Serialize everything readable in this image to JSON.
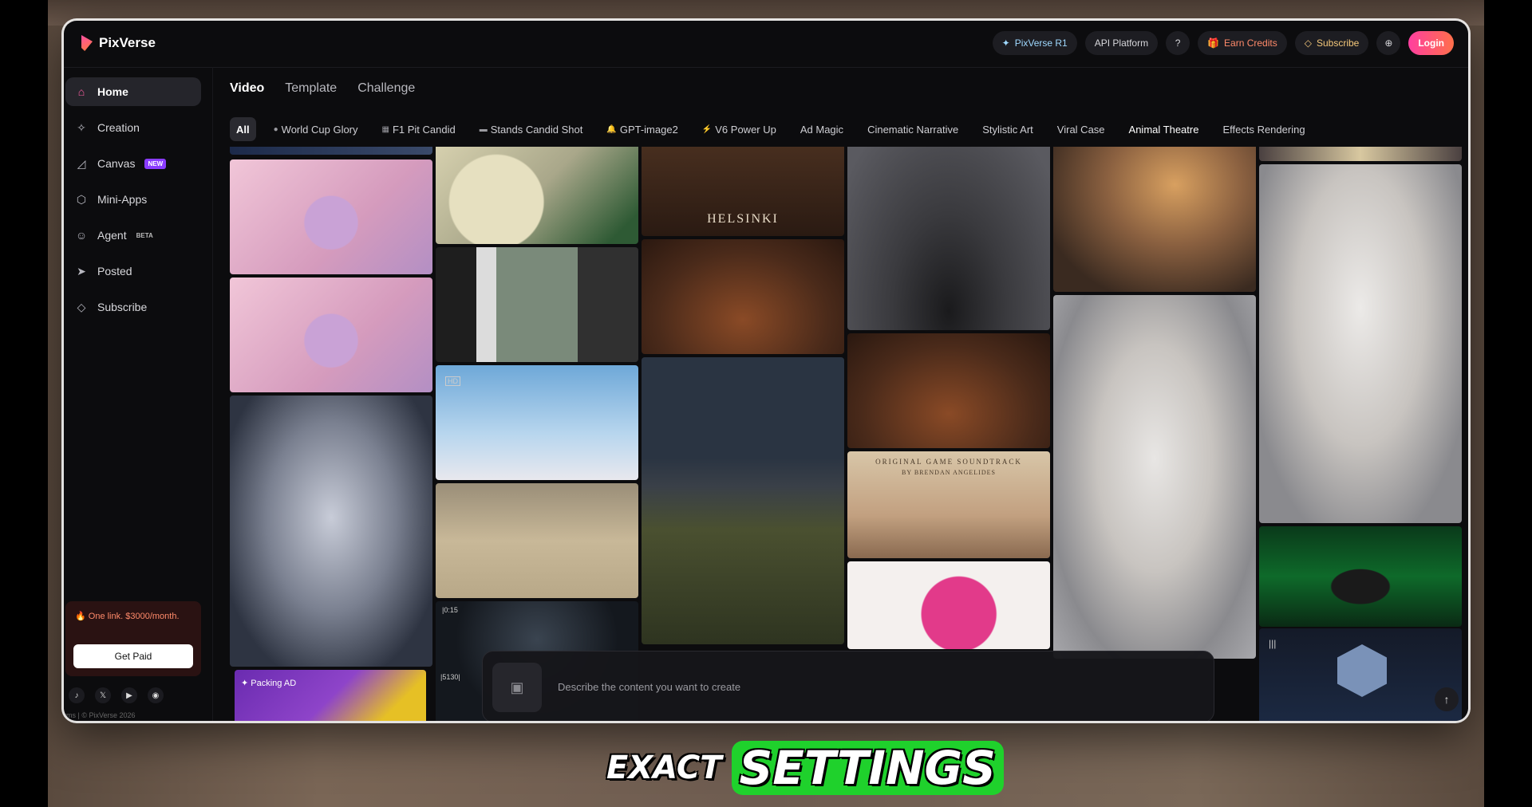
{
  "app": {
    "name": "PixVerse"
  },
  "header": {
    "pixverse_r1": "PixVerse R1",
    "api_platform": "API Platform",
    "earn_credits": "Earn Credits",
    "subscribe": "Subscribe",
    "login": "Login"
  },
  "sidebar": {
    "items": [
      {
        "label": "Home",
        "icon": "home-icon"
      },
      {
        "label": "Creation",
        "icon": "sparkle-icon"
      },
      {
        "label": "Canvas",
        "icon": "canvas-icon",
        "badge": "NEW"
      },
      {
        "label": "Mini-Apps",
        "icon": "cube-icon"
      },
      {
        "label": "Agent",
        "icon": "agent-icon",
        "badge": "BETA"
      },
      {
        "label": "Posted",
        "icon": "send-icon"
      },
      {
        "label": "Subscribe",
        "icon": "diamond-icon"
      }
    ],
    "promo": {
      "text": "One link. $3000/month.",
      "button": "Get Paid"
    },
    "footer": "rms  |  © PixVerse 2026"
  },
  "main": {
    "tabs": [
      "Video",
      "Template",
      "Challenge"
    ],
    "chips": [
      "All",
      "World Cup Glory",
      "F1 Pit Candid",
      "Stands Candid Shot",
      "GPT-image2",
      "V6 Power Up",
      "Ad Magic",
      "Cinematic Narrative",
      "Stylistic Art",
      "Viral Case",
      "Animal Theatre",
      "Effects Rendering"
    ],
    "tiles": {
      "helsinki": "HELSINKI",
      "soundtrack": "ORIGINAL GAME SOUNDTRACK",
      "soundtrack_by": "BY BRENDAN ANGELIDES",
      "packing_ad": "Packing AD",
      "hd": "HD",
      "time_a": "|0:15",
      "time_b": "|5130|"
    }
  },
  "prompt": {
    "placeholder": "Describe the content you want to create"
  },
  "caption": {
    "word1": "EXACT",
    "word2": "SETTINGS"
  },
  "colors": {
    "brand": "#ff4fa3",
    "accent_green": "#1fd12c",
    "login_gradient": "#ff3fa0"
  }
}
